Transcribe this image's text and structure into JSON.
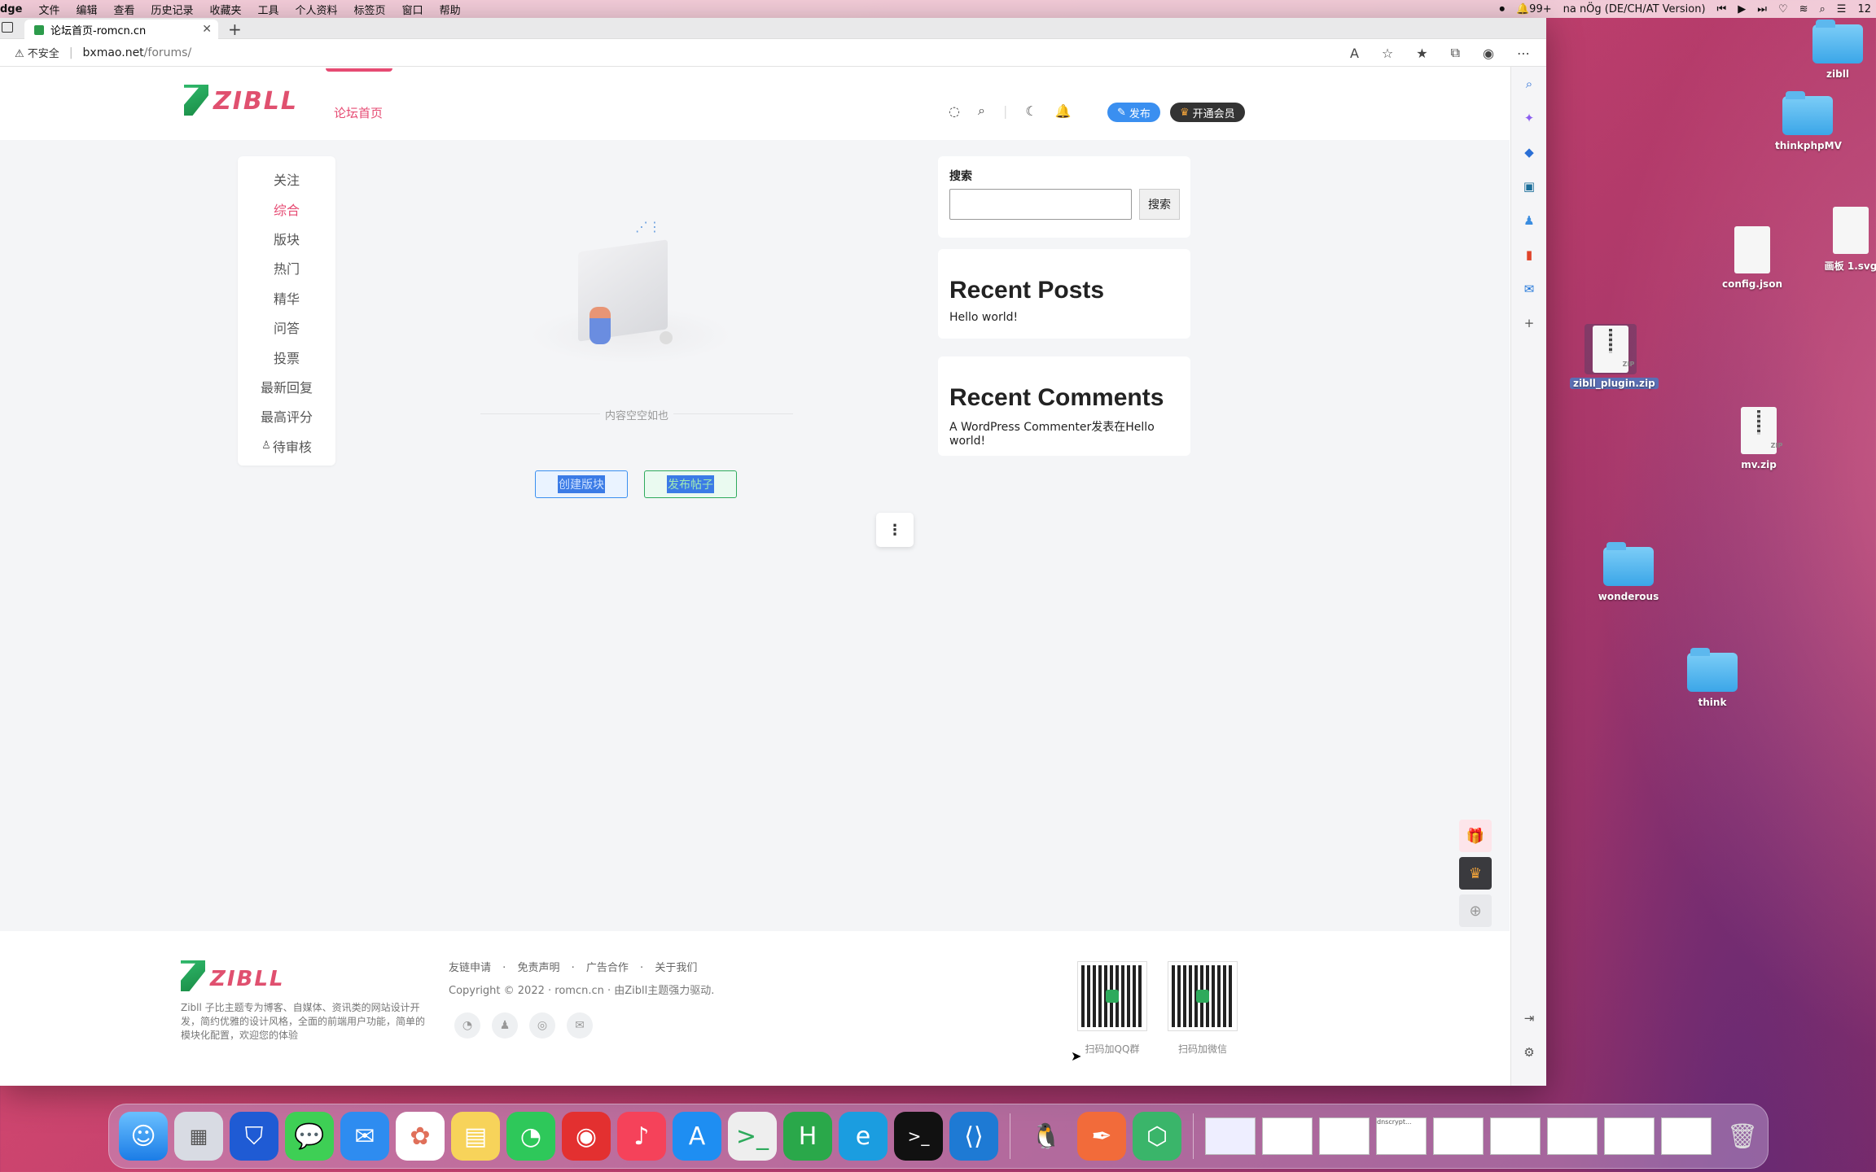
{
  "menubar": {
    "app": "dge",
    "items": [
      "文件",
      "编辑",
      "查看",
      "历史记录",
      "收藏夹",
      "工具",
      "个人资料",
      "标签页",
      "窗口",
      "帮助"
    ],
    "notif": "99+",
    "input_source": "na nÖg (DE/CH/AT Version)",
    "clock": "12"
  },
  "browser": {
    "tab_title": "论坛首页-romcn.cn",
    "security": "不安全",
    "url_host": "bxmao.net",
    "url_path": "/forums/"
  },
  "site": {
    "logo_text": "ZIBLL",
    "nav_home": "论坛首页",
    "publish": "发布",
    "vip": "开通会员"
  },
  "left_nav": {
    "items": [
      "关注",
      "综合",
      "版块",
      "热门",
      "精华",
      "问答",
      "投票",
      "最新回复",
      "最高评分",
      "待审核"
    ],
    "active_index": 1
  },
  "main": {
    "empty_text": "内容空空如也",
    "btn_create_board": "创建版块",
    "btn_publish_post": "发布帖子"
  },
  "sidebar": {
    "search_title": "搜索",
    "search_button": "搜索",
    "recent_posts_title": "Recent Posts",
    "recent_posts": [
      "Hello world!"
    ],
    "recent_comments_title": "Recent Comments",
    "recent_comments": [
      "A WordPress Commenter发表在Hello world!"
    ]
  },
  "footer": {
    "links": [
      "友链申请",
      "免责声明",
      "广告合作",
      "关于我们"
    ],
    "copyright": "Copyright © 2022 · romcn.cn · 由Zibll主题强力驱动.",
    "description": "Zibll 子比主题专为博客、自媒体、资讯类的网站设计开发，简约优雅的设计风格，全面的前端用户功能，简单的模块化配置，欢迎您的体验",
    "qr1_caption": "扫码加QQ群",
    "qr2_caption": "扫码加微信"
  },
  "desktop": {
    "icons": [
      "zibll",
      "thinkphpMV",
      "config.json",
      "画板 1.svg",
      "zibll_plugin.zip",
      "mv.zip",
      "wonderous",
      "think"
    ]
  },
  "dock": {
    "thumb_label": "dnscrypt..."
  },
  "colors": {
    "accent": "#e64b73",
    "primary_button": "#3a8ff0",
    "green": "#2eaa5c"
  }
}
